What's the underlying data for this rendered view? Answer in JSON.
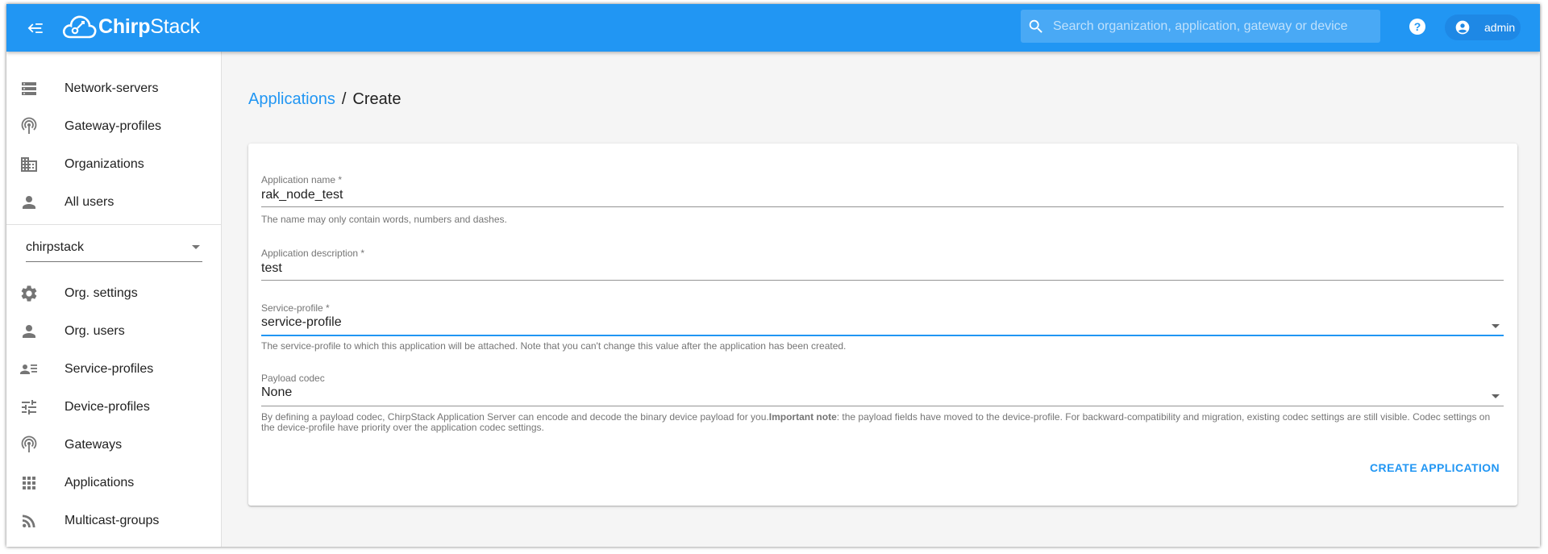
{
  "app": {
    "logo_text_bold": "Chirp",
    "logo_text_regular": "Stack"
  },
  "header": {
    "search_placeholder": "Search organization, application, gateway or device",
    "user_label": "admin"
  },
  "sidebar": {
    "admin_items": [
      {
        "label": "Network-servers",
        "icon": "server-icon"
      },
      {
        "label": "Gateway-profiles",
        "icon": "radio-tower-icon"
      },
      {
        "label": "Organizations",
        "icon": "building-icon"
      },
      {
        "label": "All users",
        "icon": "person-icon"
      }
    ],
    "org_select_value": "chirpstack",
    "org_items": [
      {
        "label": "Org. settings",
        "icon": "gear-icon"
      },
      {
        "label": "Org. users",
        "icon": "person-icon"
      },
      {
        "label": "Service-profiles",
        "icon": "account-details-icon"
      },
      {
        "label": "Device-profiles",
        "icon": "tune-icon"
      },
      {
        "label": "Gateways",
        "icon": "radio-tower-icon"
      },
      {
        "label": "Applications",
        "icon": "apps-grid-icon"
      },
      {
        "label": "Multicast-groups",
        "icon": "rss-icon"
      }
    ]
  },
  "breadcrumb": {
    "parent": "Applications",
    "separator": "/",
    "current": "Create"
  },
  "form": {
    "name": {
      "label": "Application name *",
      "value": "rak_node_test",
      "help": "The name may only contain words, numbers and dashes."
    },
    "description": {
      "label": "Application description *",
      "value": "test"
    },
    "service_profile": {
      "label": "Service-profile *",
      "value": "service-profile",
      "help": "The service-profile to which this application will be attached. Note that you can't change this value after the application has been created."
    },
    "payload_codec": {
      "label": "Payload codec",
      "value": "None",
      "help_prefix": "By defining a payload codec, ChirpStack Application Server can encode and decode the binary device payload for you.",
      "help_bold": "Important note",
      "help_suffix": ": the payload fields have moved to the device-profile. For backward-compatibility and migration, existing codec settings are still visible. Codec settings on the device-profile have priority over the application codec settings."
    },
    "submit_label": "CREATE APPLICATION"
  },
  "colors": {
    "primary": "#2196f3",
    "text": "#212121",
    "muted": "#757575"
  }
}
